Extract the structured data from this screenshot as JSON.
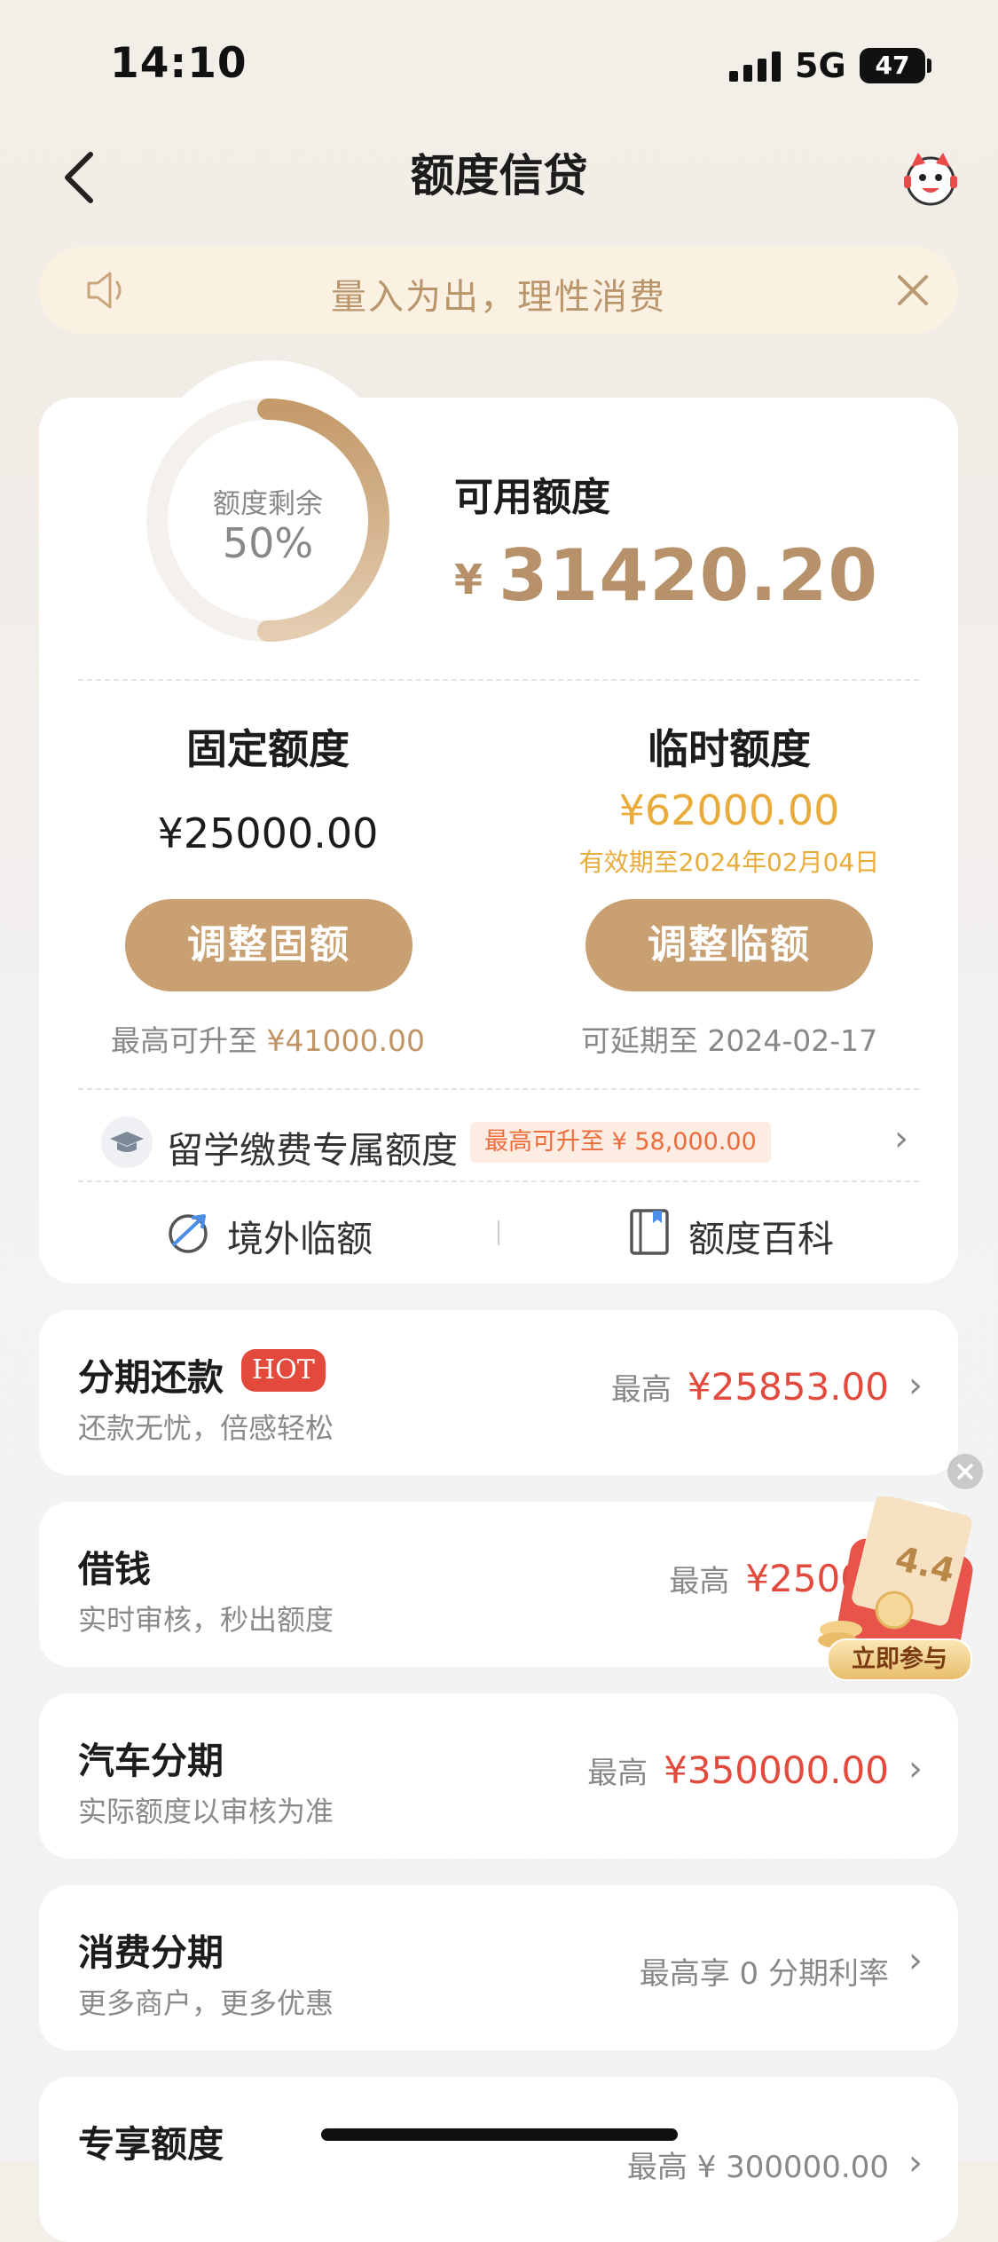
{
  "status_bar": {
    "time": "14:10",
    "network": "5G",
    "battery": "47"
  },
  "nav": {
    "title": "额度信贷"
  },
  "notice": {
    "text": "量入为出，理性消费"
  },
  "quota": {
    "ring_label": "额度剩余",
    "ring_percent_text": "50%",
    "remaining_fraction": 0.5,
    "available_label": "可用额度",
    "currency": "¥",
    "available_amount": "31420.20",
    "fixed_title": "固定额度",
    "fixed_amount": "¥25000.00",
    "fixed_button": "调整固额",
    "fixed_sub_prefix": "最高可升至",
    "fixed_sub_value": "¥41000.00",
    "temp_title": "临时额度",
    "temp_amount": "¥62000.00",
    "temp_valid": "有效期至2024年02月04日",
    "temp_button": "调整临额",
    "temp_sub": "可延期至 2024-02-17",
    "edu_label": "留学缴费专属额度",
    "edu_badge": "最高可升至 ¥ 58,000.00",
    "overseas_label": "境外临额",
    "wiki_label": "额度百科"
  },
  "products": [
    {
      "title": "分期还款",
      "badge": "HOT",
      "subtitle": "还款无忧，倍感轻松",
      "max_label": "最高",
      "value": "¥25853.00"
    },
    {
      "title": "借钱",
      "subtitle": "实时审核，秒出额度",
      "max_label": "最高",
      "value": "¥2500"
    },
    {
      "title": "汽车分期",
      "subtitle": "实际额度以审核为准",
      "max_label": "最高",
      "value": "¥350000.00"
    },
    {
      "title": "消费分期",
      "subtitle": "更多商户，更多优惠",
      "right_text": "最高享 0 分期利率"
    },
    {
      "title": "专享额度",
      "right_text": "最高 ¥ 300000.00"
    }
  ],
  "promo": {
    "badge_text": "4.4",
    "button": "立即参与"
  },
  "colors": {
    "gold": "#c8a072",
    "gold_text": "#b7916a",
    "temp_amber": "#e9ac3a",
    "red_value": "#e24a3d"
  }
}
